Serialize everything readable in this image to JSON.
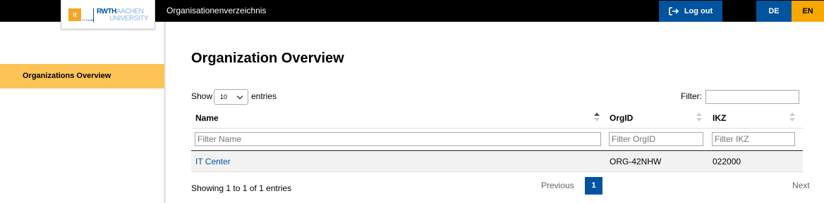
{
  "header": {
    "logo": {
      "it": "it",
      "it_caption": "IT Center",
      "rwth": "RWTH",
      "aachen": "AACHEN",
      "university": "UNIVERSITY"
    },
    "title": "Organisationenverzeichnis",
    "logout_label": "Log out",
    "lang_de": "DE",
    "lang_en": "EN"
  },
  "sidebar": {
    "items": [
      {
        "label": "Organizations Overview",
        "active": true
      }
    ]
  },
  "main": {
    "title": "Organization Overview",
    "show_label": "Show",
    "entries_value": "10",
    "entries_label": "entries",
    "filter_label": "Filter:",
    "filter_value": "",
    "columns": [
      {
        "label": "Name",
        "filter_placeholder": "Filter Name"
      },
      {
        "label": "OrgID",
        "filter_placeholder": "Filter OrgID"
      },
      {
        "label": "IKZ",
        "filter_placeholder": "Filter IKZ"
      }
    ],
    "rows": [
      {
        "name": "IT Center",
        "orgid": "ORG-42NHW",
        "ikz": "022000"
      }
    ],
    "info": "Showing 1 to 1 of 1 entries",
    "pagination": {
      "previous": "Previous",
      "current": "1",
      "next": "Next"
    }
  },
  "colors": {
    "topbar": "#000000",
    "primary_blue": "#00549f",
    "accent_orange": "#f6a800",
    "sidebar_active": "#fcc355"
  }
}
